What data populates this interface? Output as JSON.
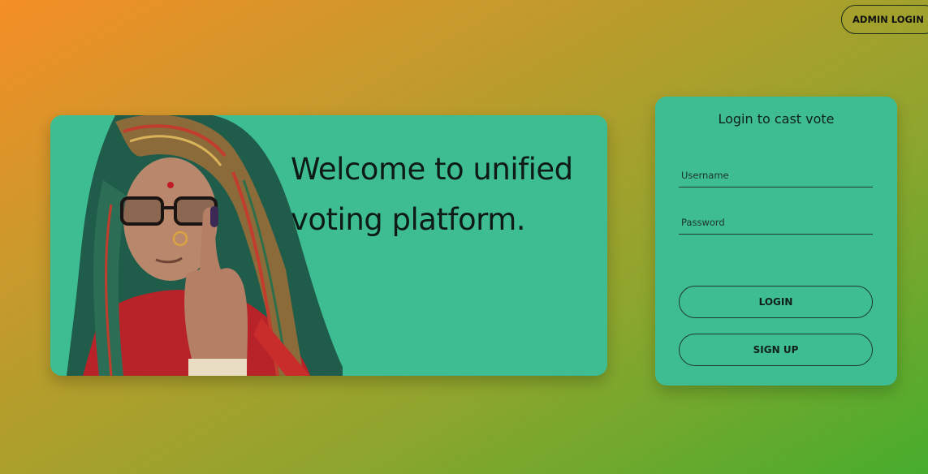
{
  "header": {
    "admin_login_label": "ADMIN LOGIN"
  },
  "hero": {
    "title": "Welcome to unified voting platform.",
    "photo": "woman-showing-inked-finger"
  },
  "login": {
    "title": "Login to cast vote",
    "username_placeholder": "Username",
    "password_placeholder": "Password",
    "login_label": "LOGIN",
    "signup_label": "SIGN UP"
  },
  "colors": {
    "card": "#3ebd93",
    "gradient_start": "#f48e26",
    "gradient_end": "#47ad2d"
  }
}
